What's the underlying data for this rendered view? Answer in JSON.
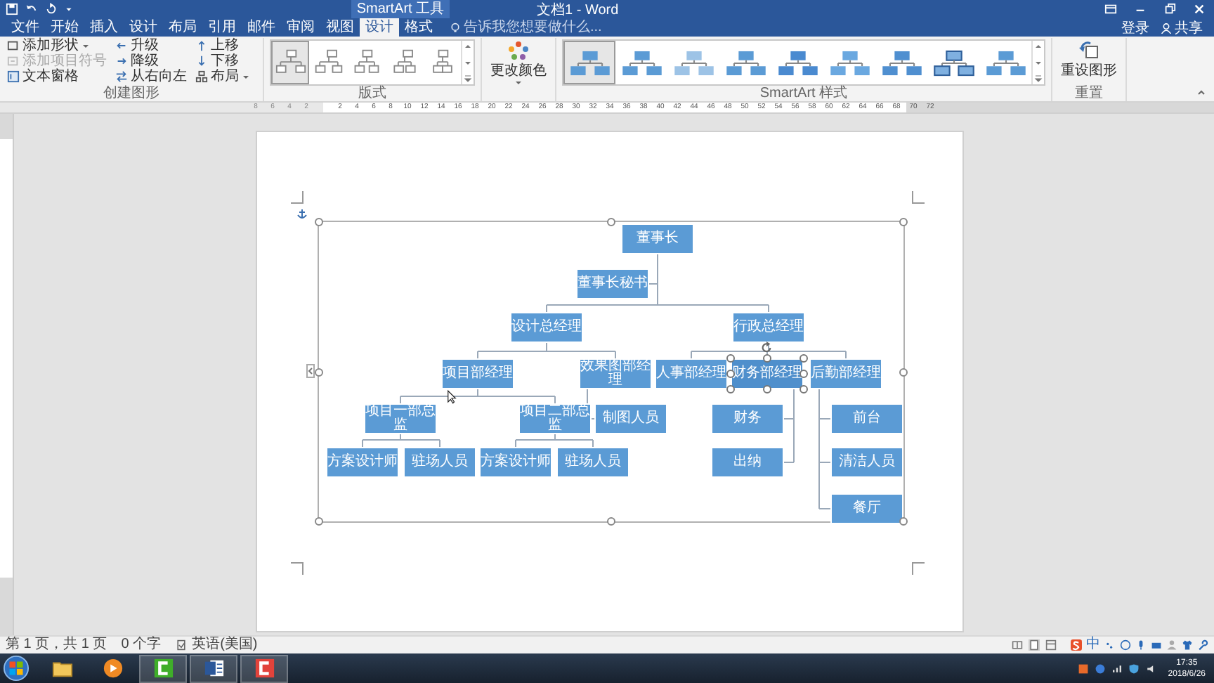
{
  "title_bar": {
    "context_group": "SmartArt 工具",
    "title": "文档1 - Word"
  },
  "tabs": [
    {
      "label": "文件",
      "selected": false
    },
    {
      "label": "开始",
      "selected": false
    },
    {
      "label": "插入",
      "selected": false
    },
    {
      "label": "设计",
      "selected": false
    },
    {
      "label": "布局",
      "selected": false
    },
    {
      "label": "引用",
      "selected": false
    },
    {
      "label": "邮件",
      "selected": false
    },
    {
      "label": "审阅",
      "selected": false
    },
    {
      "label": "视图",
      "selected": false
    },
    {
      "label": "设计",
      "selected": true
    },
    {
      "label": "格式",
      "selected": false
    }
  ],
  "search": {
    "placeholder": "告诉我您想要做什么..."
  },
  "account": {
    "sign_in": "登录",
    "share": "共享"
  },
  "ribbon": {
    "create_graphic": {
      "label": "创建图形",
      "commands": [
        {
          "label": "添加形状",
          "disabled": false,
          "kind": "dropdown"
        },
        {
          "label": "添加项目符号",
          "disabled": true,
          "kind": "button"
        },
        {
          "label": "文本窗格",
          "disabled": false,
          "kind": "button"
        },
        {
          "label": "升级",
          "disabled": false,
          "kind": "button"
        },
        {
          "label": "降级",
          "disabled": false,
          "kind": "button"
        },
        {
          "label": "从右向左",
          "disabled": false,
          "kind": "button"
        },
        {
          "label": "上移",
          "disabled": false,
          "kind": "button"
        },
        {
          "label": "下移",
          "disabled": false,
          "kind": "button"
        },
        {
          "label": "布局",
          "disabled": false,
          "kind": "dropdown"
        }
      ]
    },
    "layouts": {
      "label": "版式",
      "items": [
        {
          "selected": true
        },
        {
          "selected": false
        },
        {
          "selected": false
        },
        {
          "selected": false
        },
        {
          "selected": false
        }
      ]
    },
    "colors": {
      "label": "更改颜色"
    },
    "styles": {
      "label": "SmartArt 样式",
      "items": [
        {
          "selected": true
        },
        {
          "selected": false
        },
        {
          "selected": false
        },
        {
          "selected": false
        },
        {
          "selected": false
        },
        {
          "selected": false
        },
        {
          "selected": false
        },
        {
          "selected": false
        },
        {
          "selected": false
        }
      ]
    },
    "reset": {
      "label": "重置",
      "command": "重设图形"
    }
  },
  "ruler": {
    "left_marks": [
      "8",
      "6",
      "4",
      "2"
    ],
    "marks": [
      "2",
      "4",
      "6",
      "8",
      "10",
      "12",
      "14",
      "16",
      "18",
      "20",
      "22",
      "24",
      "26",
      "28",
      "30",
      "32",
      "34",
      "36",
      "38",
      "40",
      "42",
      "44",
      "46",
      "48",
      "50",
      "52",
      "54",
      "56",
      "58",
      "60",
      "62",
      "64",
      "66",
      "68",
      "70",
      "72"
    ]
  },
  "org_chart": {
    "root": {
      "label": "董事长",
      "selected": false,
      "children": [
        {
          "label": "董事长秘书",
          "selected": false
        },
        {
          "label": "设计总经理",
          "selected": false,
          "children": [
            {
              "label": "项目部经理",
              "selected": false,
              "children": [
                {
                  "label": "项目一部总监",
                  "selected": false,
                  "children": [
                    {
                      "label": "方案设计师",
                      "selected": false
                    },
                    {
                      "label": "驻场人员",
                      "selected": false
                    }
                  ]
                },
                {
                  "label": "项目二部总监",
                  "selected": false,
                  "children": [
                    {
                      "label": "方案设计师",
                      "selected": false
                    },
                    {
                      "label": "驻场人员",
                      "selected": false
                    }
                  ]
                }
              ]
            },
            {
              "label": "效果图部经理",
              "selected": false,
              "children": [
                {
                  "label": "制图人员",
                  "selected": false
                }
              ]
            }
          ]
        },
        {
          "label": "行政总经理",
          "selected": false,
          "children": [
            {
              "label": "人事部经理",
              "selected": false
            },
            {
              "label": "财务部经理",
              "selected": true,
              "children": [
                {
                  "label": "财务",
                  "selected": false
                },
                {
                  "label": "出纳",
                  "selected": false
                }
              ]
            },
            {
              "label": "后勤部经理",
              "selected": false,
              "children": [
                {
                  "label": "前台",
                  "selected": false
                },
                {
                  "label": "清洁人员",
                  "selected": false
                },
                {
                  "label": "餐厅",
                  "selected": false
                }
              ]
            }
          ]
        }
      ]
    }
  },
  "status_bar": {
    "page": "第 1 页，共 1 页",
    "words": "0 个字",
    "language": "英语(美国)",
    "ime": "中"
  },
  "taskbar": {
    "time": "17:35",
    "date": "2018/6/26"
  }
}
